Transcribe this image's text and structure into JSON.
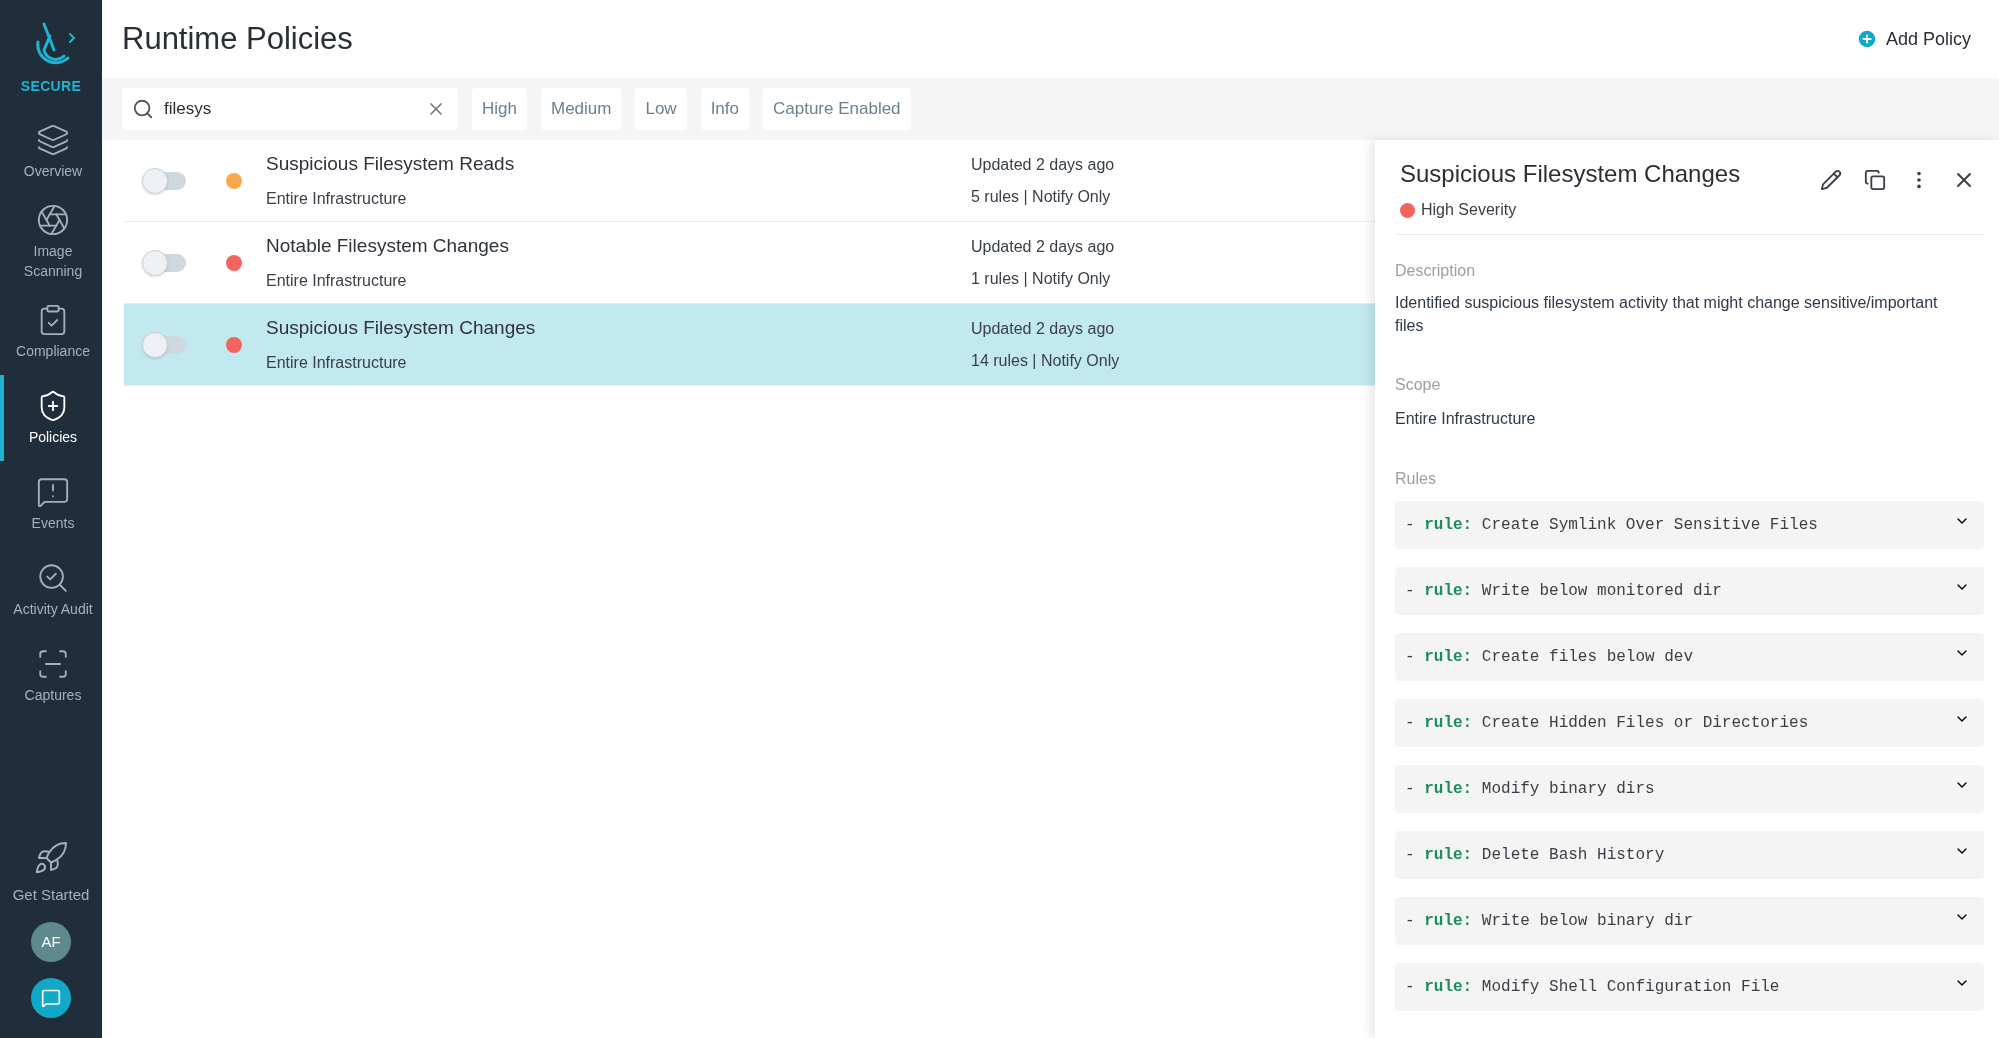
{
  "sidebar": {
    "brand": "SECURE",
    "items": [
      {
        "label": "Overview",
        "selected": false
      },
      {
        "label": "Image Scanning",
        "selected": false
      },
      {
        "label": "Compliance",
        "selected": false
      },
      {
        "label": "Policies",
        "selected": true
      },
      {
        "label": "Events",
        "selected": false
      },
      {
        "label": "Activity Audit",
        "selected": false
      },
      {
        "label": "Captures",
        "selected": false
      }
    ],
    "get_started": "Get Started",
    "avatar": "AF"
  },
  "header": {
    "title": "Runtime Policies",
    "add_button": "Add Policy"
  },
  "search": {
    "value": "filesys"
  },
  "filters": [
    {
      "label": "High",
      "selected": false
    },
    {
      "label": "Medium",
      "selected": false
    },
    {
      "label": "Low",
      "selected": false
    },
    {
      "label": "Info",
      "selected": false
    },
    {
      "label": "Capture Enabled",
      "selected": false
    }
  ],
  "policies": [
    {
      "name": "Suspicious Filesystem Reads",
      "scope": "Entire Infrastructure",
      "updated": "Updated 2 days ago",
      "summary": "5 rules | Notify Only",
      "color": "#f9a94b",
      "on": false,
      "selected": false
    },
    {
      "name": "Notable Filesystem Changes",
      "scope": "Entire Infrastructure",
      "updated": "Updated 2 days ago",
      "summary": "1 rules | Notify Only",
      "color": "#f4645f",
      "on": false,
      "selected": false
    },
    {
      "name": "Suspicious Filesystem Changes",
      "scope": "Entire Infrastructure",
      "updated": "Updated 2 days ago",
      "summary": "14 rules | Notify Only",
      "color": "#f4645f",
      "on": false,
      "selected": true
    }
  ],
  "detail": {
    "title": "Suspicious Filesystem Changes",
    "severity": {
      "label": "High Severity",
      "color": "#f4645f"
    },
    "description_label": "Description",
    "description": "Identified suspicious filesystem activity that might change sensitive/important files",
    "scope_label": "Scope",
    "scope": "Entire Infrastructure",
    "rules_label": "Rules",
    "rules": [
      {
        "text": "- **rule:** Create Symlink Over Sensitive Files",
        "expanded": false
      },
      {
        "text": "- **rule:** Write below monitored dir",
        "expanded": false
      },
      {
        "text": "- **rule:** Create files below dev",
        "expanded": false
      },
      {
        "text": "- **rule:** Create Hidden Files or Directories",
        "expanded": false
      },
      {
        "text": "- **rule:** Modify binary dirs",
        "expanded": false
      },
      {
        "text": "- **rule:** Delete Bash History",
        "expanded": false
      },
      {
        "text": "- **rule:** Write below binary dir",
        "expanded": false
      },
      {
        "text": "- **rule:** Modify Shell Configuration File",
        "expanded": false
      }
    ]
  }
}
